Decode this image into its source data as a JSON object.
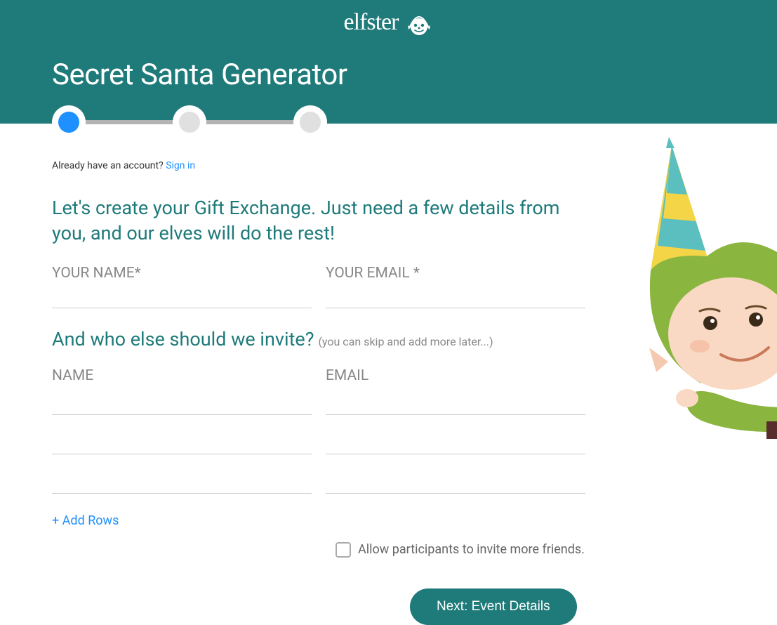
{
  "brand": {
    "name": "elfster"
  },
  "page": {
    "title": "Secret Santa Generator"
  },
  "stepper": {
    "steps": [
      {
        "active": true
      },
      {
        "active": false
      },
      {
        "active": false
      }
    ]
  },
  "auth": {
    "prompt": "Already have an account?",
    "signin_link": "Sign in"
  },
  "intro": {
    "heading": "Let's create your Gift Exchange. Just need a few details from you, and our elves will do the rest!"
  },
  "your_fields": {
    "name_label": "YOUR NAME*",
    "email_label": "YOUR EMAIL *"
  },
  "invite": {
    "heading": "And who else should we invite?",
    "hint": "(you can skip and add more later...)",
    "name_label": "NAME",
    "email_label": "EMAIL",
    "rows": 3,
    "add_rows_label": "+ Add Rows",
    "allow_invite_label": "Allow participants to invite more friends."
  },
  "buttons": {
    "next": "Next: Event Details"
  }
}
